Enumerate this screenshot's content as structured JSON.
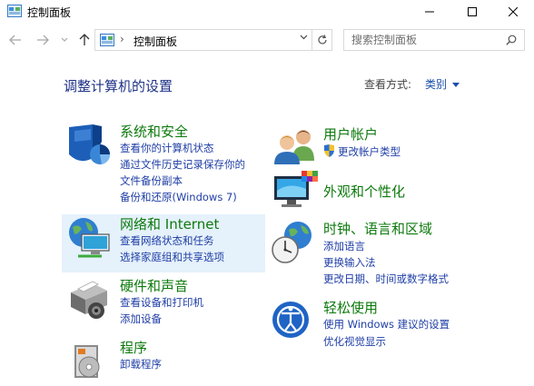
{
  "window": {
    "title": "控制面板"
  },
  "address": {
    "path": "控制面板",
    "separator": "›"
  },
  "search": {
    "placeholder": "搜索控制面板"
  },
  "header": {
    "title": "调整计算机的设置",
    "view_label": "查看方式:",
    "view_value": "类别"
  },
  "categories": [
    {
      "id": "system-security",
      "title": "系统和安全",
      "links": [
        "查看你的计算机状态",
        "通过文件历史记录保存你的",
        "文件备份副本",
        "备份和还原(Windows 7)"
      ]
    },
    {
      "id": "network",
      "title": "网络和 Internet",
      "links": [
        "查看网络状态和任务",
        "选择家庭组和共享选项"
      ]
    },
    {
      "id": "hardware",
      "title": "硬件和声音",
      "links": [
        "查看设备和打印机",
        "添加设备"
      ]
    },
    {
      "id": "programs",
      "title": "程序",
      "links": [
        "卸载程序"
      ]
    },
    {
      "id": "user-accounts",
      "title": "用户帐户",
      "links": [
        "更改帐户类型"
      ]
    },
    {
      "id": "appearance",
      "title": "外观和个性化",
      "links": []
    },
    {
      "id": "clock-region",
      "title": "时钟、语言和区域",
      "links": [
        "添加语言",
        "更换输入法",
        "更改日期、时间或数字格式"
      ]
    },
    {
      "id": "ease-of-access",
      "title": "轻松使用",
      "links": [
        "使用 Windows 建议的设置",
        "优化视觉显示"
      ]
    }
  ],
  "colors": {
    "title_blue": "#1e3287",
    "category_green": "#0d7a0d",
    "link_blue": "#1f3ea6",
    "hover_bg": "#e5f1fb"
  }
}
